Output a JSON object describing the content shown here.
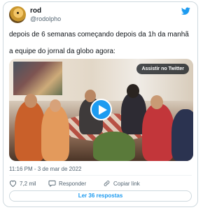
{
  "author": {
    "name": "rod",
    "handle": "@rodolpho",
    "avatar": "avatar"
  },
  "icons": {
    "brand": "twitter-bird-icon",
    "play": "play-icon",
    "like": "heart-icon",
    "reply": "speech-bubble-icon",
    "share": "link-icon"
  },
  "colors": {
    "accent": "#1d9bf0",
    "text": "#0f1419",
    "muted": "#536471",
    "border": "#cfd9de"
  },
  "tweet": {
    "line1": "depois de 6 semanas começando depois da 1h da manhã",
    "line2": "a equipe do jornal da globo agora:"
  },
  "media": {
    "watch_label": "Assistir no Twitter"
  },
  "meta": {
    "timestamp": "11:16 PM - 3 de mar de 2022"
  },
  "actions": {
    "likes": "7,2 mil",
    "reply_label": "Responder",
    "copy_link_label": "Copiar link"
  },
  "more_replies": "Ler 36 respostas"
}
